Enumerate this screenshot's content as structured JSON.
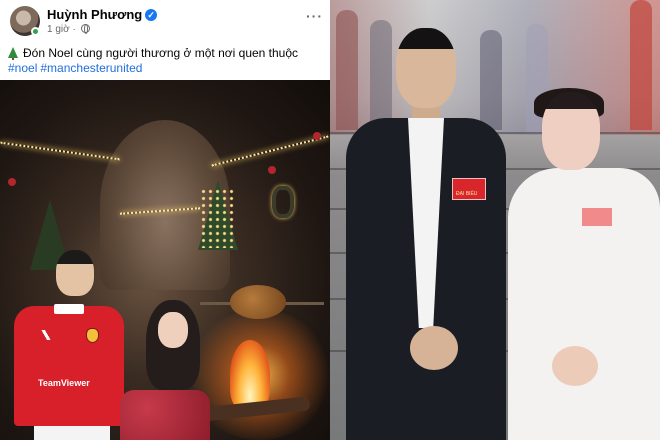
{
  "post": {
    "author": "Huỳnh Phương",
    "time": "1 giờ",
    "more": "···",
    "caption": "Đón Noel cùng người thương ở một nơi quen thuộc",
    "hashtags": [
      "#noel",
      "#manchesterunited"
    ]
  },
  "post_photo": {
    "shirt_text": "TeamViewer"
  },
  "event_photo": {
    "badge_text": "ĐẠI BIỂU"
  },
  "colors": {
    "link": "#216fdb",
    "verified": "#1877f2",
    "shirt": "#d8202a",
    "suit": "#1b1d24",
    "dress": "#f4f2f1"
  },
  "icons": [
    "verified-icon",
    "globe-icon",
    "more-icon",
    "christmas-tree-icon"
  ]
}
